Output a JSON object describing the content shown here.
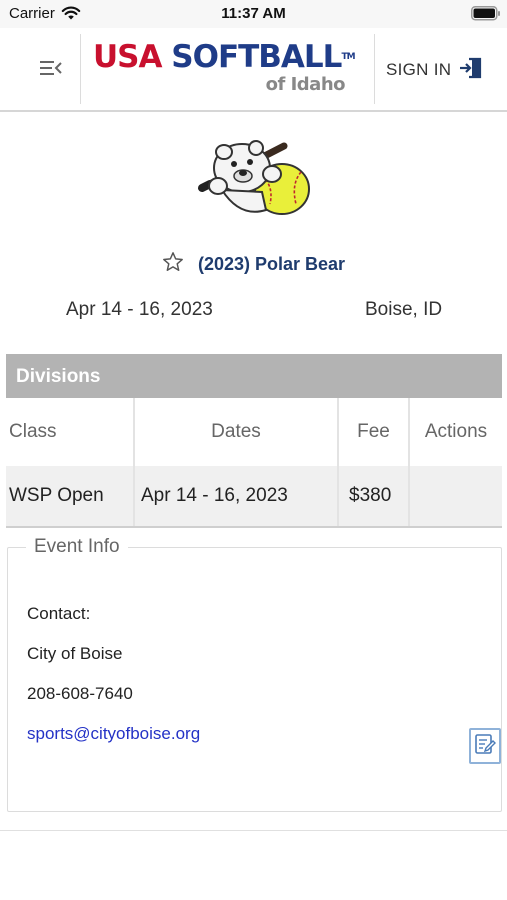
{
  "status_bar": {
    "carrier": "Carrier",
    "time": "11:37 AM"
  },
  "header": {
    "logo_usa": "USA",
    "logo_softball": "SOFTBALL",
    "logo_tm": "TM",
    "logo_sub": "of Idaho",
    "sign_in_label": "SIGN IN"
  },
  "icons": {
    "menu": "menu-collapse-icon",
    "sign_in": "sign-in-icon",
    "favorite": "star-outline-icon",
    "note": "notes-icon",
    "wifi": "wifi-icon",
    "battery": "battery-icon"
  },
  "event": {
    "title": "(2023) Polar Bear",
    "dates": "Apr 14 - 16, 2023",
    "location": "Boise, ID"
  },
  "divisions": {
    "heading": "Divisions",
    "columns": [
      "Class",
      "Dates",
      "Fee",
      "Actions"
    ],
    "rows": [
      {
        "class": "WSP Open",
        "dates": "Apr 14 - 16, 2023",
        "fee": "$380",
        "actions": ""
      }
    ]
  },
  "event_info": {
    "heading": "Event Info",
    "contact_label": "Contact:",
    "organization": "City of Boise",
    "phone": "208-608-7640",
    "email": "sports@cityofboise.org"
  },
  "colors": {
    "brand_red": "#c8102e",
    "brand_blue": "#1f3c88",
    "title_blue": "#1f3c6e",
    "link": "#2432c6",
    "divisions_header_bg": "#b3b3b3"
  }
}
